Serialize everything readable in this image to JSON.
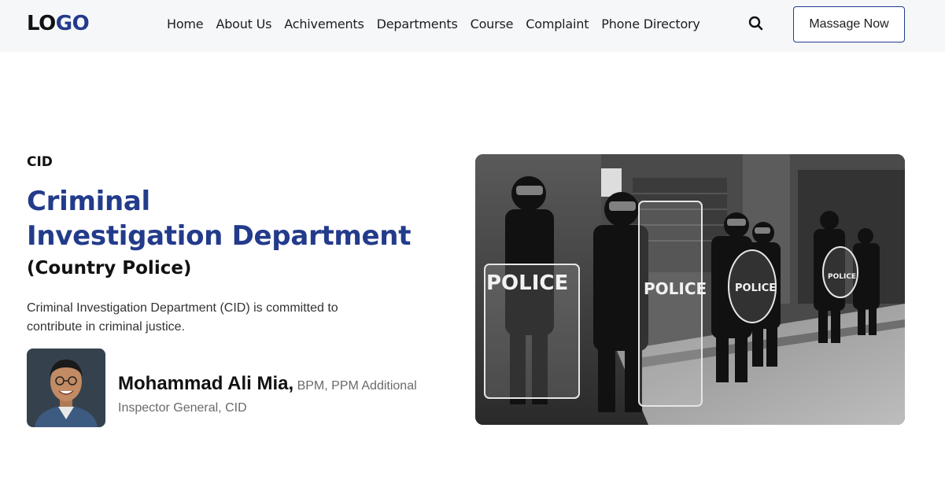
{
  "header": {
    "logo": {
      "part1": "LO",
      "part2": "GO"
    },
    "nav": [
      "Home",
      "About Us",
      "Achivements",
      "Departments",
      "Course",
      "Complaint",
      "Phone Directory"
    ],
    "search_icon": "search-icon",
    "cta_label": "Massage Now"
  },
  "hero": {
    "eyebrow": "CID",
    "title_line1": "Criminal",
    "title_line2": "Investigation Department",
    "subtitle": "(Country Police)",
    "description": "Criminal Investigation Department (CID) is committed to contribute in criminal justice.",
    "person": {
      "name": "Mohammad Ali Mia,",
      "role": " BPM, PPM Additional Inspector General, CID"
    },
    "photo_shield_text": [
      "POLICE",
      "POLICE",
      "POLICE",
      "POLICE"
    ]
  },
  "colors": {
    "accent": "#233b8b",
    "nav_bg": "#f6f7f9",
    "text": "#111111"
  }
}
